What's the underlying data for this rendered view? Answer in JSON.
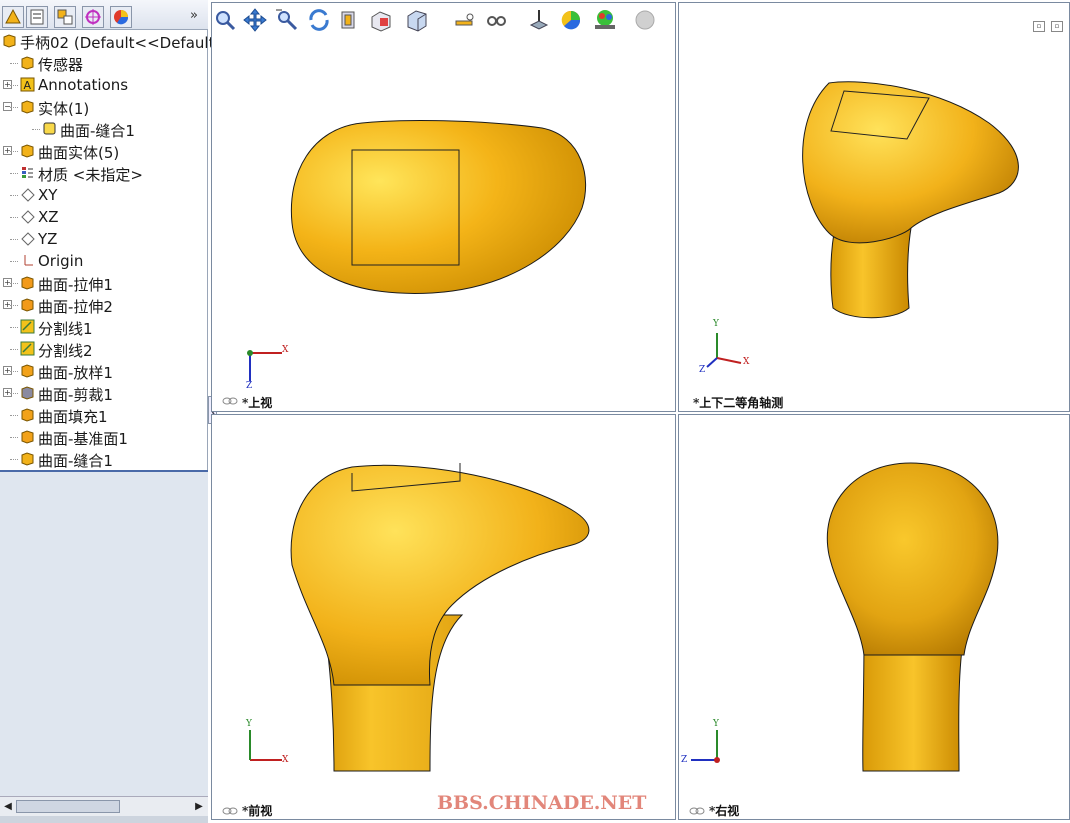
{
  "feature_manager": {
    "more_glyph": "»",
    "tabs": [
      {
        "icon": "feature-tree-icon"
      },
      {
        "icon": "property-manager-icon"
      },
      {
        "icon": "configuration-manager-icon"
      },
      {
        "icon": "dimxpert-icon"
      },
      {
        "icon": "display-manager-icon"
      }
    ],
    "tree": [
      {
        "label": "手柄02  (Default<<Default",
        "icon": "part-icon",
        "expand": "",
        "indent": 0
      },
      {
        "label": "传感器",
        "icon": "sensor-folder-icon",
        "expand": "",
        "indent": 1
      },
      {
        "label": "Annotations",
        "icon": "annotations-icon",
        "expand": "+",
        "indent": 1
      },
      {
        "label": "实体(1)",
        "icon": "solid-bodies-folder-icon",
        "expand": "-",
        "indent": 1
      },
      {
        "label": "曲面-缝合1",
        "icon": "solid-body-icon",
        "expand": "",
        "indent": 2
      },
      {
        "label": "曲面实体(5)",
        "icon": "surface-bodies-folder-icon",
        "expand": "+",
        "indent": 1
      },
      {
        "label": "材质  <未指定>",
        "icon": "material-icon",
        "expand": "",
        "indent": 1
      },
      {
        "label": "XY",
        "icon": "plane-icon",
        "expand": "",
        "indent": 1
      },
      {
        "label": "XZ",
        "icon": "plane-icon",
        "expand": "",
        "indent": 1
      },
      {
        "label": "YZ",
        "icon": "plane-icon",
        "expand": "",
        "indent": 1
      },
      {
        "label": "Origin",
        "icon": "origin-icon",
        "expand": "",
        "indent": 1
      },
      {
        "label": "曲面-拉伸1",
        "icon": "surface-extrude-icon",
        "expand": "+",
        "indent": 1
      },
      {
        "label": "曲面-拉伸2",
        "icon": "surface-extrude-icon",
        "expand": "+",
        "indent": 1
      },
      {
        "label": "分割线1",
        "icon": "split-line-icon",
        "expand": "",
        "indent": 1
      },
      {
        "label": "分割线2",
        "icon": "split-line-icon",
        "expand": "",
        "indent": 1
      },
      {
        "label": "曲面-放样1",
        "icon": "surface-loft-icon",
        "expand": "+",
        "indent": 1
      },
      {
        "label": "曲面-剪裁1",
        "icon": "surface-trim-icon",
        "expand": "+",
        "indent": 1
      },
      {
        "label": "曲面填充1",
        "icon": "surface-fill-icon",
        "expand": "",
        "indent": 1
      },
      {
        "label": "曲面-基准面1",
        "icon": "planar-surface-icon",
        "expand": "",
        "indent": 1
      },
      {
        "label": "曲面-缝合1",
        "icon": "surface-knit-icon",
        "expand": "",
        "indent": 1
      }
    ]
  },
  "toolbar": [
    {
      "icon": "zoom-to-area-icon"
    },
    {
      "icon": "pan-icon"
    },
    {
      "icon": "zoom-in-out-icon"
    },
    {
      "icon": "rotate-view-icon"
    },
    {
      "icon": "section-view-icon"
    },
    {
      "icon": "view-orientation-icon"
    },
    {
      "icon": "display-style-icon"
    },
    {
      "icon": "hide-show-items-icon"
    },
    {
      "icon": "view-glasses-icon"
    },
    {
      "icon": "apply-scene-icon"
    },
    {
      "icon": "appearance-icon"
    },
    {
      "icon": "realview-icon"
    },
    {
      "icon": "shadows-icon"
    }
  ],
  "viewports": {
    "top": {
      "label": "*上视",
      "axis_h": "X",
      "axis_v": "Z"
    },
    "iso": {
      "label": "*上下二等角轴测",
      "axis_y": "Y",
      "axis_x": "X",
      "axis_z": "Z"
    },
    "front": {
      "label": "*前视",
      "axis_h": "X",
      "axis_v": "Y"
    },
    "right": {
      "label": "*右视",
      "axis_h": "Z",
      "axis_v": "Y"
    }
  },
  "window_buttons": [
    "restore-viewport-icon",
    "close-viewport-icon"
  ],
  "watermark": "BBS.CHINADE.NET",
  "colors": {
    "model": "#f2b21a",
    "model_dark": "#c07f00",
    "panel": "#dfe6ef",
    "accent": "#4a6aa8"
  }
}
